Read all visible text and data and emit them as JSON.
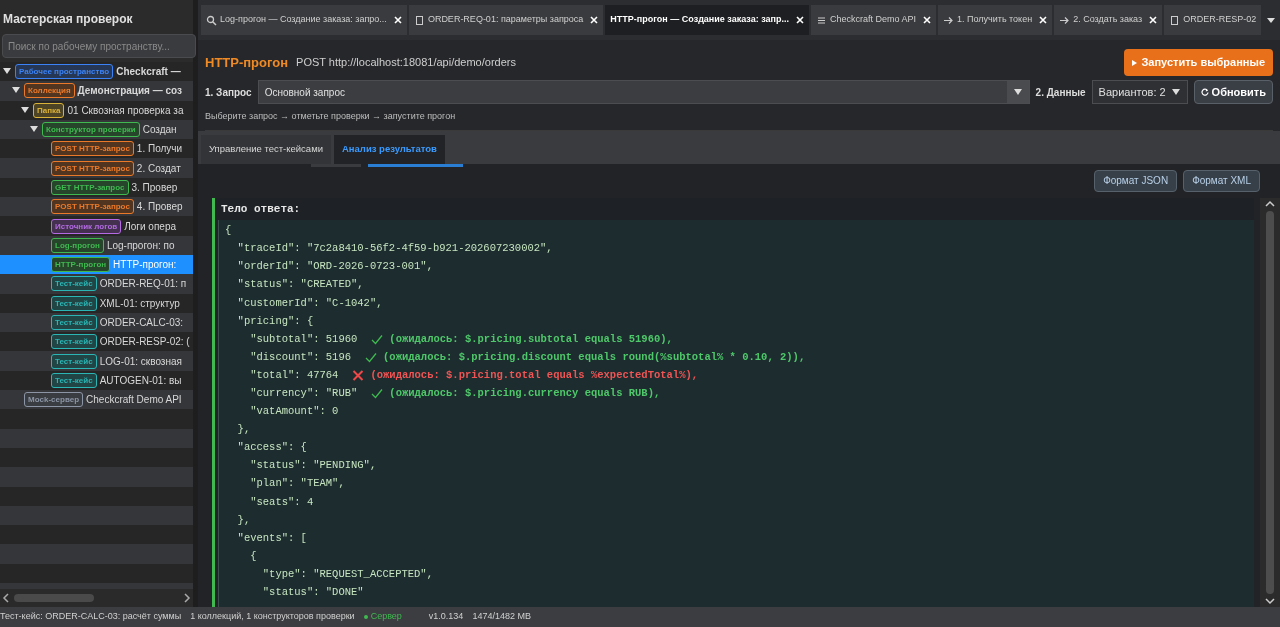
{
  "sidebar": {
    "title": "Мастерская проверок",
    "search": {
      "placeholder": "Поиск по рабочему пространству..."
    },
    "tree": [
      {
        "tag": "Рабочее пространство",
        "color": "#3b82f6",
        "text": "Checkcraft —",
        "bold": true,
        "expanded": true,
        "selected": false,
        "children": [
          {
            "tag": "Коллекция",
            "color": "#ea7a2a",
            "text": "Демонстрация — соз",
            "bold": true,
            "expanded": true,
            "selected": false,
            "children": [
              {
                "tag": "Папка",
                "color": "#d9b23a",
                "text": "01 Сквозная проверка за",
                "bold": false,
                "expanded": true,
                "selected": false,
                "children": [
                  {
                    "tag": "Конструктор проверки",
                    "color": "#3fb950",
                    "text": "Создан",
                    "bold": false,
                    "expanded": true,
                    "selected": false,
                    "children": [
                      {
                        "tag": "POST HTTP-запрос",
                        "color": "#ea7a2a",
                        "text": "1. Получи",
                        "bold": false,
                        "selected": false
                      },
                      {
                        "tag": "POST HTTP-запрос",
                        "color": "#ea7a2a",
                        "text": "2. Создат",
                        "bold": false,
                        "selected": false
                      },
                      {
                        "tag": "GET HTTP-запрос",
                        "color": "#3fb950",
                        "text": "3. Провер",
                        "bold": false,
                        "selected": false
                      },
                      {
                        "tag": "POST HTTP-запрос",
                        "color": "#ea7a2a",
                        "text": "4. Провер",
                        "bold": false,
                        "selected": false
                      },
                      {
                        "tag": "Источник логов",
                        "color": "#b36ae2",
                        "text": "Логи опера",
                        "bold": false,
                        "selected": false
                      },
                      {
                        "tag": "Log-прогон",
                        "color": "#3fb950",
                        "text": "Log-прогон: по",
                        "bold": false,
                        "selected": false
                      },
                      {
                        "tag": "HTTP-прогон",
                        "color": "#3fb950",
                        "text": "HTTP-прогон:",
                        "bold": false,
                        "selected": true
                      },
                      {
                        "tag": "Тест-кейс",
                        "color": "#2bb5b5",
                        "text": "ORDER-REQ-01: п",
                        "bold": false,
                        "selected": false
                      },
                      {
                        "tag": "Тест-кейс",
                        "color": "#2bb5b5",
                        "text": "XML-01: структур",
                        "bold": false,
                        "selected": false
                      },
                      {
                        "tag": "Тест-кейс",
                        "color": "#2bb5b5",
                        "text": "ORDER-CALC-03:",
                        "bold": false,
                        "selected": false
                      },
                      {
                        "tag": "Тест-кейс",
                        "color": "#2bb5b5",
                        "text": "ORDER-RESP-02: (",
                        "bold": false,
                        "selected": false
                      },
                      {
                        "tag": "Тест-кейс",
                        "color": "#2bb5b5",
                        "text": "LOG-01: сквозная",
                        "bold": false,
                        "selected": false
                      },
                      {
                        "tag": "Тест-кейс",
                        "color": "#2bb5b5",
                        "text": "AUTOGEN-01: вы",
                        "bold": false,
                        "selected": false
                      }
                    ]
                  }
                ]
              }
            ]
          },
          {
            "tag": "Mock-сервер",
            "color": "#8b95a5",
            "text": "Checkcraft Demo API",
            "bold": false,
            "selected": false
          }
        ]
      }
    ]
  },
  "tabs": [
    {
      "kind": "search",
      "label": "Log-прогон — Создание заказа: запро...",
      "selected": false
    },
    {
      "kind": "doc",
      "label": "ORDER-REQ-01: параметры запроса",
      "selected": false
    },
    {
      "kind": "none",
      "label": "HTTP-прогон — Создание заказа: запр...",
      "selected": true
    },
    {
      "kind": "list",
      "label": "Checkcraft Demo API",
      "selected": false
    },
    {
      "kind": "arrow",
      "label": "1. Получить токен",
      "selected": false
    },
    {
      "kind": "arrow",
      "label": "2. Создать заказ",
      "selected": false
    },
    {
      "kind": "doc",
      "label": "ORDER-RESP-02",
      "selected": false
    }
  ],
  "header": {
    "title": "HTTP-прогон",
    "url": "POST http://localhost:18081/api/demo/orders",
    "run_button": "Запустить выбранные",
    "request_label": "1. Запрос",
    "request_value": "Основной запрос",
    "data_label": "2. Данные",
    "data_value": "Вариантов: 2",
    "refresh_button": "Обновить",
    "hint": "Выберите запрос → отметьте проверки → запустите прогон"
  },
  "subtabs": [
    {
      "label": "Управление тест-кейсами",
      "selected": false
    },
    {
      "label": "Анализ результатов",
      "selected": true
    }
  ],
  "format_buttons": [
    "Формат JSON",
    "Формат XML"
  ],
  "response": {
    "heading": "Тело ответа:",
    "lines": [
      {
        "text": "{"
      },
      {
        "text": "  \"traceId\": \"7c2a8410-56f2-4f59-b921-202607230002\","
      },
      {
        "text": "  \"orderId\": \"ORD-2026-0723-001\","
      },
      {
        "text": "  \"status\": \"CREATED\","
      },
      {
        "text": "  \"customerId\": \"C-1042\","
      },
      {
        "text": "  \"pricing\": {"
      },
      {
        "text": "    \"subtotal\": 51960",
        "check": {
          "passed": true,
          "text": "(ожидалось: $.pricing.subtotal equals 51960),"
        }
      },
      {
        "text": "    \"discount\": 5196",
        "check": {
          "passed": true,
          "text": "(ожидалось: $.pricing.discount equals round(%subtotal% * 0.10, 2)),"
        }
      },
      {
        "text": "    \"total\": 47764",
        "check": {
          "passed": false,
          "text": "(ожидалось: $.pricing.total equals %expectedTotal%),"
        }
      },
      {
        "text": "    \"currency\": \"RUB\"",
        "check": {
          "passed": true,
          "text": "(ожидалось: $.pricing.currency equals RUB),"
        }
      },
      {
        "text": "    \"vatAmount\": 0"
      },
      {
        "text": "  },"
      },
      {
        "text": "  \"access\": {"
      },
      {
        "text": "    \"status\": \"PENDING\","
      },
      {
        "text": "    \"plan\": \"TEAM\","
      },
      {
        "text": "    \"seats\": 4"
      },
      {
        "text": "  },"
      },
      {
        "text": "  \"events\": ["
      },
      {
        "text": "    {"
      },
      {
        "text": "      \"type\": \"REQUEST_ACCEPTED\","
      },
      {
        "text": "      \"status\": \"DONE\""
      }
    ]
  },
  "status_bar": {
    "selection": "Тест-кейс: ORDER-CALC-03: расчёт суммы",
    "counts": "1 коллекций, 1 конструкторов проверки",
    "server": {
      "label": "Сервер",
      "online": true
    },
    "version": "v1.0.134",
    "memory": "1474/1482 MB"
  }
}
